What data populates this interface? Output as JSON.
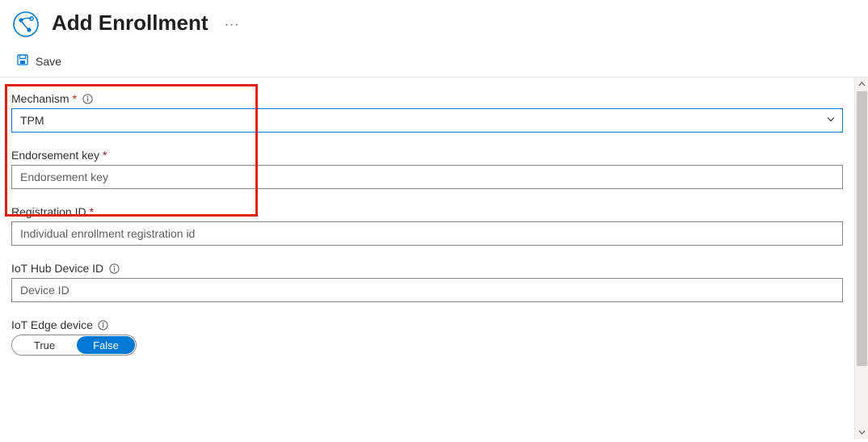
{
  "header": {
    "title": "Add Enrollment",
    "more": "···"
  },
  "toolbar": {
    "save_label": "Save"
  },
  "fields": {
    "mechanism": {
      "label": "Mechanism",
      "required": "*",
      "value": "TPM"
    },
    "endorsement": {
      "label": "Endorsement key",
      "required": "*",
      "placeholder": "Endorsement key",
      "value": ""
    },
    "registration": {
      "label": "Registration ID",
      "required": "*",
      "placeholder": "Individual enrollment registration id",
      "value": ""
    },
    "deviceid": {
      "label": "IoT Hub Device ID",
      "placeholder": "Device ID",
      "value": ""
    },
    "edge": {
      "label": "IoT Edge device",
      "option_true": "True",
      "option_false": "False",
      "selected": "False"
    }
  },
  "colors": {
    "accent": "#0078d4",
    "highlight_border": "#e3200f",
    "required": "#a4262c"
  }
}
